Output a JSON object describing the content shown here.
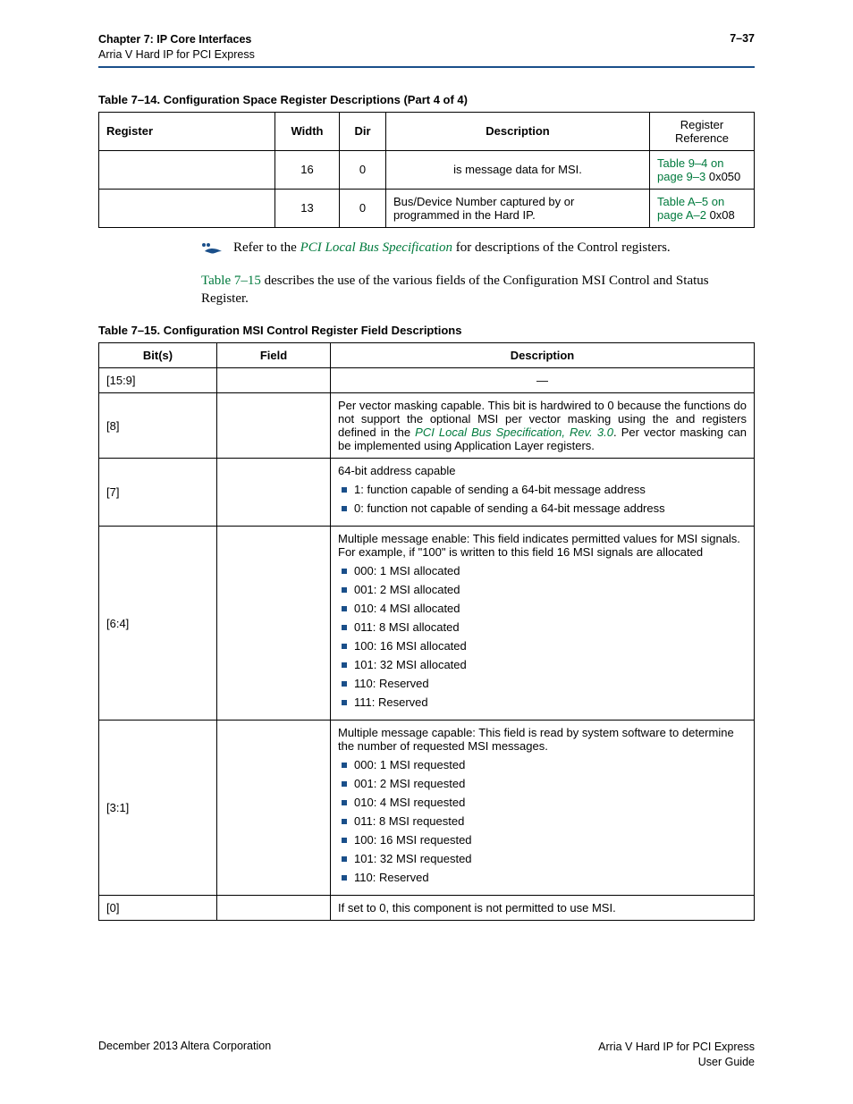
{
  "header": {
    "chapter": "Chapter 7: IP Core Interfaces",
    "subtitle": "Arria V Hard IP for PCI Express",
    "pageno": "7–37"
  },
  "table14": {
    "caption": "Table 7–14.  Configuration Space Register Descriptions   (Part 4 of 4)",
    "headers": {
      "register": "Register",
      "width": "Width",
      "dir": "Dir",
      "desc": "Description",
      "ref": "Register Reference"
    },
    "rows": [
      {
        "register": "",
        "width": "16",
        "dir": "0",
        "desc": "is message data for MSI.",
        "ref_link": "Table 9–4 on page 9–3",
        "ref_suffix": " 0x050"
      },
      {
        "register": "",
        "width": "13",
        "dir": "0",
        "desc": "Bus/Device Number captured by or programmed in the Hard IP.",
        "ref_link": "Table A–5 on page A–2",
        "ref_suffix": " 0x08"
      }
    ]
  },
  "note": {
    "prefix": "Refer to the ",
    "link": "PCI Local Bus Specification",
    "suffix": " for descriptions of the Control registers."
  },
  "para": {
    "link": "Table 7–15",
    "rest": " describes the use of the various fields of the Configuration MSI Control and Status Register."
  },
  "table15": {
    "caption": "Table 7–15.   Configuration MSI Control Register Field Descriptions",
    "headers": {
      "bits": "Bit(s)",
      "field": "Field",
      "desc": "Description"
    },
    "rows": {
      "r0": {
        "bits": "[15:9]",
        "desc_center": "—"
      },
      "r1": {
        "bits": "[8]",
        "desc_pre": "Per vector masking capable. This bit is hardwired to 0 because the functions do not support the optional MSI per vector masking using the ",
        "desc_mid": " and ",
        "desc_post1": " registers defined in the ",
        "desc_link": "PCI Local Bus Specification, Rev. 3.0",
        "desc_post2": ". Per vector masking can be implemented using Application Layer registers."
      },
      "r2": {
        "bits": "[7]",
        "intro": "64-bit address capable",
        "items": [
          "1: function capable of sending a 64-bit message address",
          "0: function not capable of sending a 64-bit message address"
        ]
      },
      "r3": {
        "bits": "[6:4]",
        "intro": "Multiple message enable: This field indicates permitted values for MSI signals. For example, if \"100\" is written to this field 16 MSI signals are allocated",
        "items": [
          "000: 1 MSI allocated",
          "001: 2 MSI allocated",
          "010: 4 MSI allocated",
          "011: 8 MSI allocated",
          "100: 16 MSI allocated",
          "101: 32 MSI allocated",
          "110: Reserved",
          "111: Reserved"
        ]
      },
      "r4": {
        "bits": "[3:1]",
        "intro": "Multiple message capable: This field is read by system software to determine the number of requested MSI messages.",
        "items": [
          "000: 1 MSI requested",
          "001: 2 MSI requested",
          "010: 4 MSI requested",
          "011: 8 MSI requested",
          "100: 16 MSI requested",
          "101: 32 MSI requested",
          "110: Reserved"
        ]
      },
      "r5": {
        "bits": "[0]",
        "desc": "If set to 0, this component is not permitted to use MSI."
      }
    }
  },
  "footer": {
    "left": "December 2013   Altera Corporation",
    "right1": "Arria V Hard IP for PCI Express",
    "right2": "User Guide"
  }
}
